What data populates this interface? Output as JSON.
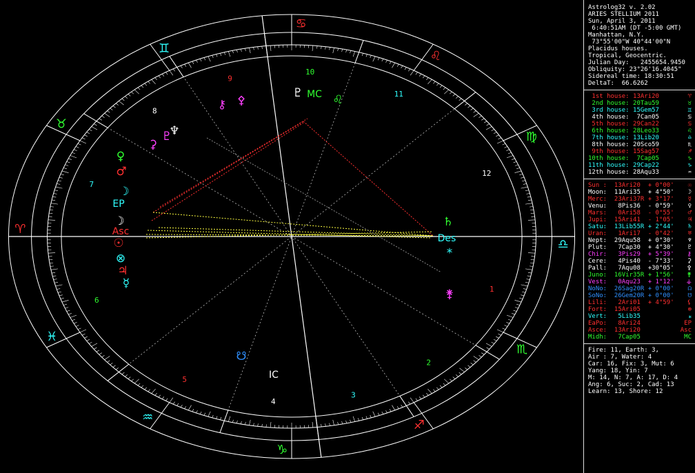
{
  "header": [
    "Astrolog32 v. 2.02",
    "ARIES STELLIUM 2011",
    "Sun, April 3, 2011",
    " 6:40:51AM (DT -5:00 GMT)",
    "Manhattan, N.Y.",
    " 73°55'00\"W 40°44'00\"N",
    "Placidus houses.",
    "Tropical, Geocentric.",
    "Julian Day:   2455654.9450",
    "Obliquity: 23°26'16.4045\"",
    "Sidereal time: 18:30:51",
    "DeltaT:  66.6262"
  ],
  "houses": [
    {
      "text": " 1st house: 13Ari20",
      "glyph": "♈",
      "color": "#ff3030"
    },
    {
      "text": " 2nd house: 20Tau59",
      "glyph": "♉",
      "color": "#30ff30"
    },
    {
      "text": " 3rd house: 15Gem57",
      "glyph": "♊",
      "color": "#30ffff"
    },
    {
      "text": " 4th house:  7Can05",
      "glyph": "♋",
      "color": "#ffffff"
    },
    {
      "text": " 5th house: 29Can22",
      "glyph": "♋",
      "color": "#ff3030"
    },
    {
      "text": " 6th house: 28Leo33",
      "glyph": "♌",
      "color": "#30ff30"
    },
    {
      "text": " 7th house: 13Lib20",
      "glyph": "♎",
      "color": "#30ffff"
    },
    {
      "text": " 8th house: 20Sco59",
      "glyph": "♏",
      "color": "#ffffff"
    },
    {
      "text": " 9th house: 15Sag57",
      "glyph": "♐",
      "color": "#ff3030"
    },
    {
      "text": "10th house:  7Cap05",
      "glyph": "♑",
      "color": "#30ff30"
    },
    {
      "text": "11th house: 29Cap22",
      "glyph": "♑",
      "color": "#30ffff"
    },
    {
      "text": "12th house: 28Aqu33",
      "glyph": "♒",
      "color": "#ffffff"
    }
  ],
  "planets": [
    {
      "text": "Sun :  13Ari20  + 0°00'",
      "glyph": "☉",
      "color": "#ff3030"
    },
    {
      "text": "Moon:  11Ari35  + 4°50'",
      "glyph": "☽",
      "color": "#ffffff"
    },
    {
      "text": "Merc:  23Ari37R + 3°17'",
      "glyph": "☿",
      "color": "#ff3030"
    },
    {
      "text": "Venu:   8Pis36  - 0°59'",
      "glyph": "♀",
      "color": "#ffffff"
    },
    {
      "text": "Mars:   0Ari58  - 0°55'",
      "glyph": "♂",
      "color": "#ff3030"
    },
    {
      "text": "Jupi:  15Ari41  - 1°05'",
      "glyph": "♃",
      "color": "#ff3030"
    },
    {
      "text": "Satu:  13Lib55R + 2°44'",
      "glyph": "♄",
      "color": "#30ffff"
    },
    {
      "text": "Uran:   1Ari17  - 0°42'",
      "glyph": "♅",
      "color": "#ff3030"
    },
    {
      "text": "Nept:  29Aqu58  + 0°30'",
      "glyph": "♆",
      "color": "#ffffff"
    },
    {
      "text": "Plut:   7Cap30  + 4°30'",
      "glyph": "♇",
      "color": "#ffffff"
    },
    {
      "text": "Chir:   3Pis29  + 5°39'",
      "glyph": "⚷",
      "color": "#ff40ff"
    },
    {
      "text": "Cere:   4Pis40  - 7°33'",
      "glyph": "⚳",
      "color": "#ffffff"
    },
    {
      "text": "Pall:   7Aqu08  +30°05'",
      "glyph": "⚴",
      "color": "#ffffff"
    },
    {
      "text": "Juno:  16Vir35R + 1°56'",
      "glyph": "⚵",
      "color": "#30ff30"
    },
    {
      "text": "Vest:   0Aqu23  + 1°12'",
      "glyph": "⚶",
      "color": "#ff40ff"
    },
    {
      "text": "NoNo:  26Sag20R + 0°00'",
      "glyph": "☊",
      "color": "#3090ff"
    },
    {
      "text": "SoNo:  26Gem20R + 0°00'",
      "glyph": "☋",
      "color": "#3090ff"
    },
    {
      "text": "Lili:   2Ari01  + 4°59'",
      "glyph": "⚸",
      "color": "#ff3030"
    },
    {
      "text": "Fort:  15Ari05",
      "glyph": "⊗",
      "color": "#ff3030"
    },
    {
      "text": "Vert:   5Lib35",
      "glyph": "⁎",
      "color": "#30ffff"
    },
    {
      "text": "EaPo:   8Ari24",
      "glyph": "EP",
      "color": "#ff3030"
    },
    {
      "text": "Asce:  13Ari20",
      "glyph": "Asc",
      "color": "#ff3030"
    },
    {
      "text": "Midh:   7Cap05",
      "glyph": "MC",
      "color": "#30ff30"
    }
  ],
  "stats": [
    "Fire: 11, Earth: 3,",
    "Air : 7, Water: 4",
    "Car: 16, Fix: 3, Mut: 6",
    "Yang: 18, Yin: 7",
    "M: 14, N: 7, A: 17, D: 4",
    "Ang: 6, Suc: 2, Cad: 13",
    "Learn: 13, Shore: 12"
  ],
  "wheel": {
    "house_numbers": [
      "1",
      "2",
      "3",
      "4",
      "5",
      "6",
      "7",
      "8",
      "9",
      "10",
      "11",
      "12"
    ],
    "sign_glyphs": [
      "♈",
      "♉",
      "♊",
      "♋",
      "♌",
      "♍",
      "♎",
      "♏",
      "♐",
      "♑",
      "♒",
      "♓"
    ],
    "axis_labels": {
      "mc": "MC",
      "ic": "IC",
      "asc": "Asc",
      "des": "Des"
    },
    "colors": {
      "red": "#ff3030",
      "green": "#30ff30",
      "cyan": "#30ffff",
      "white": "#ffffff",
      "magenta": "#ff40ff",
      "yellow": "#ffff40",
      "blue": "#3090ff"
    }
  }
}
